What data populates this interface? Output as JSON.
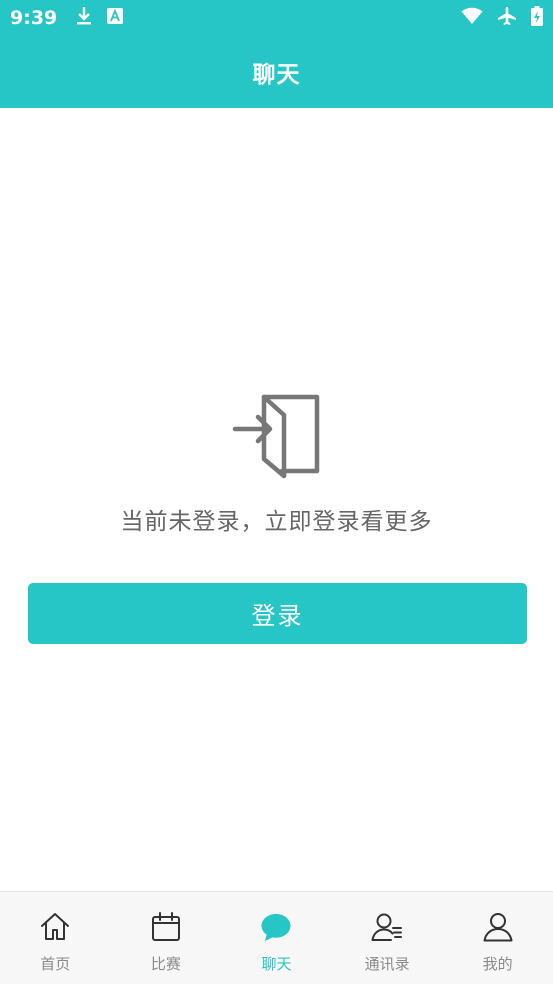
{
  "status_bar": {
    "time": "9:39",
    "left_icons": [
      "download-icon",
      "app-a-icon"
    ],
    "right_icons": [
      "wifi-icon",
      "airplane-icon",
      "battery-charging-icon"
    ]
  },
  "header": {
    "title": "聊天"
  },
  "main": {
    "icon": "login-door-icon",
    "empty_message": "当前未登录，立即登录看更多",
    "login_button_label": "登录"
  },
  "tab_bar": {
    "active_index": 2,
    "tabs": [
      {
        "label": "首页",
        "icon": "home-icon"
      },
      {
        "label": "比赛",
        "icon": "calendar-icon"
      },
      {
        "label": "聊天",
        "icon": "chat-bubble-icon"
      },
      {
        "label": "通讯录",
        "icon": "contacts-icon"
      },
      {
        "label": "我的",
        "icon": "profile-icon"
      }
    ]
  },
  "colors": {
    "accent": "#26c6c6",
    "inactive_tab": "#8a8a8a",
    "message_text": "#666666"
  }
}
